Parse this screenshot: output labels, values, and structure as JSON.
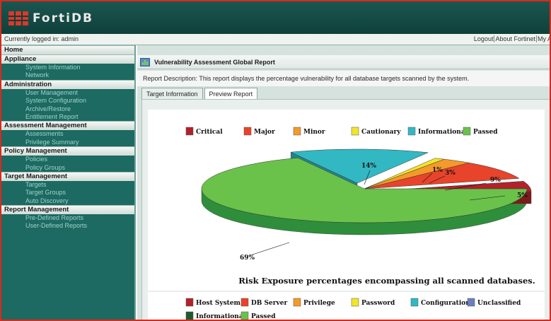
{
  "header": {
    "logo_text": "FortiDB"
  },
  "login": {
    "status": "Currently logged in: admin",
    "links": [
      "Logout",
      "About Fortinet",
      "My Acco"
    ]
  },
  "sidebar": {
    "sections": [
      {
        "label": "Home",
        "items": []
      },
      {
        "label": "Appliance",
        "items": [
          "System Information",
          "Network"
        ]
      },
      {
        "label": "Administration",
        "items": [
          "User Management",
          "System Configuration",
          "Archive/Restore",
          "Entitlement Report"
        ]
      },
      {
        "label": "Assessment Management",
        "items": [
          "Assessments",
          "Privilege Summary"
        ]
      },
      {
        "label": "Policy Management",
        "items": [
          "Policies",
          "Policy Groups"
        ]
      },
      {
        "label": "Target Management",
        "items": [
          "Targets",
          "Target Groups",
          "Auto Discovery"
        ]
      },
      {
        "label": "Report Management",
        "items": [
          "Pre-Defined Reports",
          "User-Defined Reports"
        ]
      }
    ]
  },
  "main": {
    "title": "Vulnerability Assessment Global Report",
    "description": "Report Description: This report displays the percentage vulnerability for all database targets scanned by the system.",
    "tabs": [
      {
        "label": "Target Information",
        "active": false
      },
      {
        "label": "Preview Report",
        "active": true
      }
    ]
  },
  "chart_data": {
    "type": "pie",
    "title": "",
    "caption": "Risk Exposure percentages encompassing all scanned databases.",
    "legend_position": "top",
    "categories": [
      "Critical",
      "Major",
      "Minor",
      "Cautionary",
      "Informational",
      "Passed"
    ],
    "values": [
      5,
      9,
      3,
      1,
      14,
      69
    ],
    "value_labels": [
      "5%",
      "9%",
      "3%",
      "1%",
      "14%",
      "69%"
    ],
    "colors": [
      "#b3212b",
      "#e8432b",
      "#f39a2a",
      "#f2e52a",
      "#32b8c2",
      "#6ac24a"
    ],
    "side_colors": [
      "#7d1a1c",
      "#a53220",
      "#b5721b",
      "#b0a71d",
      "#23858c",
      "#2f8e3b"
    ]
  },
  "legend2": {
    "entries": [
      {
        "label": "Host System",
        "color": "#b3212b"
      },
      {
        "label": "DB Server",
        "color": "#e8432b"
      },
      {
        "label": "Privilege",
        "color": "#f39a2a"
      },
      {
        "label": "Password",
        "color": "#f2e52a"
      },
      {
        "label": "Configuration",
        "color": "#32b8c2"
      },
      {
        "label": "Unclassified",
        "color": "#6c7fbf"
      },
      {
        "label": "Informational",
        "color": "#1d5a32"
      },
      {
        "label": "Passed",
        "color": "#6ac24a"
      }
    ]
  }
}
